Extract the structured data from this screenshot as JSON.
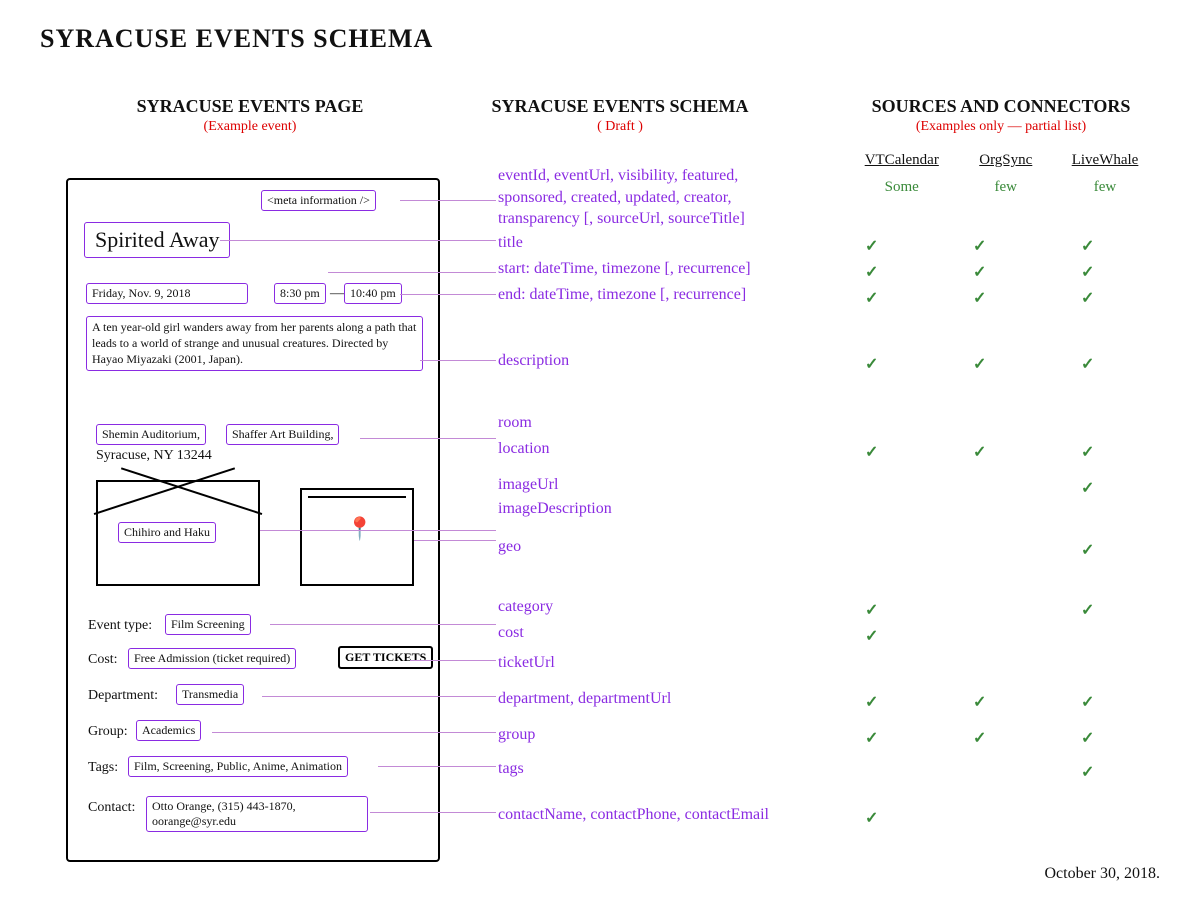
{
  "page_title": "SYRACUSE EVENTS SCHEMA",
  "columns": {
    "left": {
      "title": "SYRACUSE EVENTS PAGE",
      "sub": "(Example event)"
    },
    "middle": {
      "title": "SYRACUSE EVENTS SCHEMA",
      "sub": "( Draft )"
    },
    "right": {
      "title": "SOURCES AND CONNECTORS",
      "sub": "(Examples only — partial list)"
    }
  },
  "example": {
    "meta_label": "<meta information />",
    "title": "Spirited Away",
    "date": "Friday, Nov. 9, 2018",
    "start_time": "8:30 pm",
    "time_sep": "—",
    "end_time": "10:40 pm",
    "description": "A ten year-old girl wanders away from her parents along a path that leads to a world of strange and unusual creatures. Directed by Hayao Miyazaki (2001, Japan).",
    "room": "Shemin Auditorium,",
    "building": "Shaffer Art Building,",
    "city": "Syracuse, NY 13244",
    "image_caption": "Chihiro and Haku",
    "event_type_label": "Event type:",
    "event_type": "Film Screening",
    "cost_label": "Cost:",
    "cost": "Free Admission (ticket required)",
    "ticket_btn": "GET TICKETS",
    "dept_label": "Department:",
    "dept": "Transmedia",
    "group_label": "Group:",
    "group": "Academics",
    "tags_label": "Tags:",
    "tags": "Film, Screening, Public, Anime, Animation",
    "contact_label": "Contact:",
    "contact": "Otto Orange, (315) 443-1870, oorange@syr.edu"
  },
  "schema": {
    "meta": "eventId, eventUrl, visibility, featured, sponsored, created, updated, creator, transparency [, sourceUrl, sourceTitle]",
    "title": "title",
    "start": "start: dateTime, timezone [, recurrence]",
    "end": "end: dateTime, timezone [, recurrence]",
    "description": "description",
    "room": "room",
    "location": "location",
    "imageUrl": "imageUrl",
    "imageDescription": "imageDescription",
    "geo": "geo",
    "category": "category",
    "cost": "cost",
    "ticketUrl": "ticketUrl",
    "department": "department, departmentUrl",
    "group": "group",
    "tags": "tags",
    "contact": "contactName, contactPhone, contactEmail"
  },
  "sources": {
    "headers": [
      "VTCalendar",
      "OrgSync",
      "LiveWhale"
    ],
    "summary": [
      "Some",
      "few",
      "few"
    ],
    "rows": [
      {
        "key": "title",
        "cells": [
          "✓",
          "✓",
          "✓"
        ]
      },
      {
        "key": "start",
        "cells": [
          "✓",
          "✓",
          "✓"
        ]
      },
      {
        "key": "end",
        "cells": [
          "✓",
          "✓",
          "✓"
        ]
      },
      {
        "key": "description",
        "cells": [
          "✓",
          "✓",
          "✓"
        ]
      },
      {
        "key": "room",
        "cells": [
          "",
          "",
          ""
        ]
      },
      {
        "key": "location",
        "cells": [
          "✓",
          "✓",
          "✓"
        ]
      },
      {
        "key": "imageUrl",
        "cells": [
          "",
          "",
          "✓"
        ]
      },
      {
        "key": "imageDescription",
        "cells": [
          "",
          "",
          ""
        ]
      },
      {
        "key": "geo",
        "cells": [
          "",
          "",
          "✓"
        ]
      },
      {
        "key": "spacer1",
        "cells": [
          "",
          "",
          ""
        ]
      },
      {
        "key": "category",
        "cells": [
          "✓",
          "",
          "✓"
        ]
      },
      {
        "key": "cost",
        "cells": [
          "✓",
          "",
          ""
        ]
      },
      {
        "key": "ticketUrl",
        "cells": [
          "",
          "",
          ""
        ]
      },
      {
        "key": "department",
        "cells": [
          "✓",
          "✓",
          "✓"
        ]
      },
      {
        "key": "group",
        "cells": [
          "✓",
          "✓",
          "✓"
        ]
      },
      {
        "key": "tags",
        "cells": [
          "",
          "",
          "✓"
        ]
      },
      {
        "key": "contact",
        "cells": [
          "✓",
          "",
          ""
        ]
      }
    ]
  },
  "footer_date": "October 30, 2018."
}
